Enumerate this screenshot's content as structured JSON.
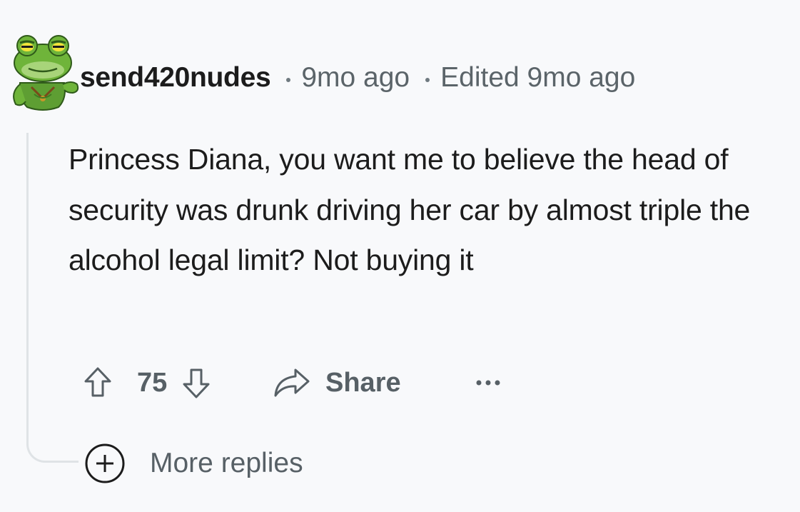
{
  "comment": {
    "username": "send420nudes",
    "age": "9mo ago",
    "edited": "Edited 9mo ago",
    "body": "Princess Diana, you want me to believe the head of security was drunk driving her car by almost triple the alcohol legal limit? Not buying it",
    "avatar_icon": "frog-avatar-icon"
  },
  "actions": {
    "score": "75",
    "upvote_icon": "arrow-up-icon",
    "downvote_icon": "arrow-down-icon",
    "share_icon": "share-arrow-icon",
    "share_label": "Share",
    "more_icon": "ellipsis-icon"
  },
  "more_replies": {
    "icon": "plus-circle-icon",
    "label": "More replies"
  },
  "colors": {
    "background": "#f8f9fb",
    "text": "#1c1c1c",
    "meta": "#5b6469",
    "thread_line": "#dfe3e6",
    "avatar_green": "#6fb43a"
  }
}
